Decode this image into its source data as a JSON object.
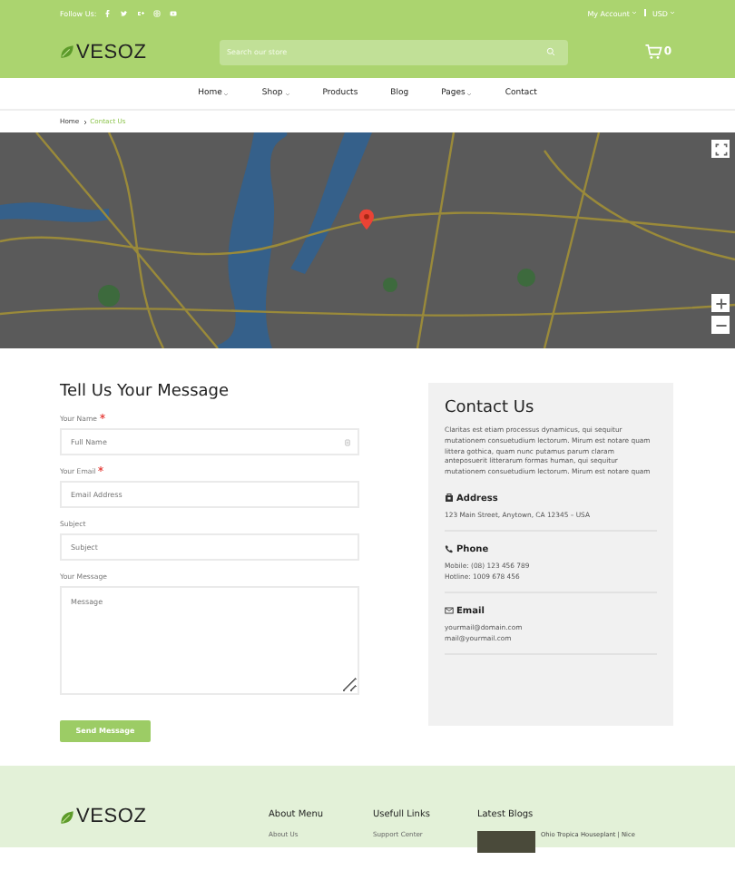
{
  "topbar": {
    "follow_label": "Follow Us:",
    "account": "My Account",
    "currency": "USD"
  },
  "header": {
    "logo": "VESOZ",
    "search": {
      "placeholder": "Search our store"
    },
    "cart_count": "0"
  },
  "nav": [
    {
      "label": "Home",
      "dropdown": true
    },
    {
      "label": "Shop",
      "dropdown": true
    },
    {
      "label": "Products",
      "dropdown": false
    },
    {
      "label": "Blog",
      "dropdown": false
    },
    {
      "label": "Pages",
      "dropdown": true
    },
    {
      "label": "Contact",
      "dropdown": false
    }
  ],
  "breadcrumb": [
    {
      "label": "Home",
      "current": false
    },
    {
      "label": "Contact Us",
      "current": true
    }
  ],
  "form": {
    "title": "Tell Us Your Message",
    "fields": [
      {
        "label": "Your Name",
        "required": true,
        "placeholder": "Full Name",
        "kind": "input",
        "icon": true
      },
      {
        "label": "Your Email",
        "required": true,
        "placeholder": "Email Address",
        "kind": "input",
        "icon": false
      },
      {
        "label": "Subject",
        "required": false,
        "placeholder": "Subject",
        "kind": "input",
        "icon": false
      },
      {
        "label": "Your Message",
        "required": false,
        "placeholder": "Message",
        "kind": "textarea"
      }
    ],
    "submit": "Send Message"
  },
  "contact": {
    "title": "Contact Us",
    "intro": "Claritas est etiam processus dynamicus, qui sequitur mutationem consuetudium lectorum. Mirum est notare quam littera gothica, quam nunc putamus parum claram anteposuerit litterarum formas human, qui sequitur mutationem consuetudium lectorum. Mirum est notare quam",
    "sections": [
      {
        "kind": "address",
        "heading": "Address",
        "lines": [
          "123 Main Street, Anytown, CA 12345 – USA"
        ]
      },
      {
        "kind": "phone",
        "heading": "Phone",
        "lines": [
          "Mobile: (08) 123 456 789",
          "Hotline: 1009 678 456"
        ]
      },
      {
        "kind": "email",
        "heading": "Email",
        "lines": [
          "yourmail@domain.com",
          "mail@yourmail.com"
        ]
      }
    ]
  },
  "footer": {
    "logo": "VESOZ",
    "columns": [
      {
        "heading": "About Menu",
        "links": [
          "About Us"
        ]
      },
      {
        "heading": "Usefull Links",
        "links": [
          "Support Center"
        ]
      }
    ],
    "blogs": {
      "heading": "Latest Blogs",
      "posts": [
        "Ohio Tropica Houseplant | Nice"
      ]
    }
  }
}
